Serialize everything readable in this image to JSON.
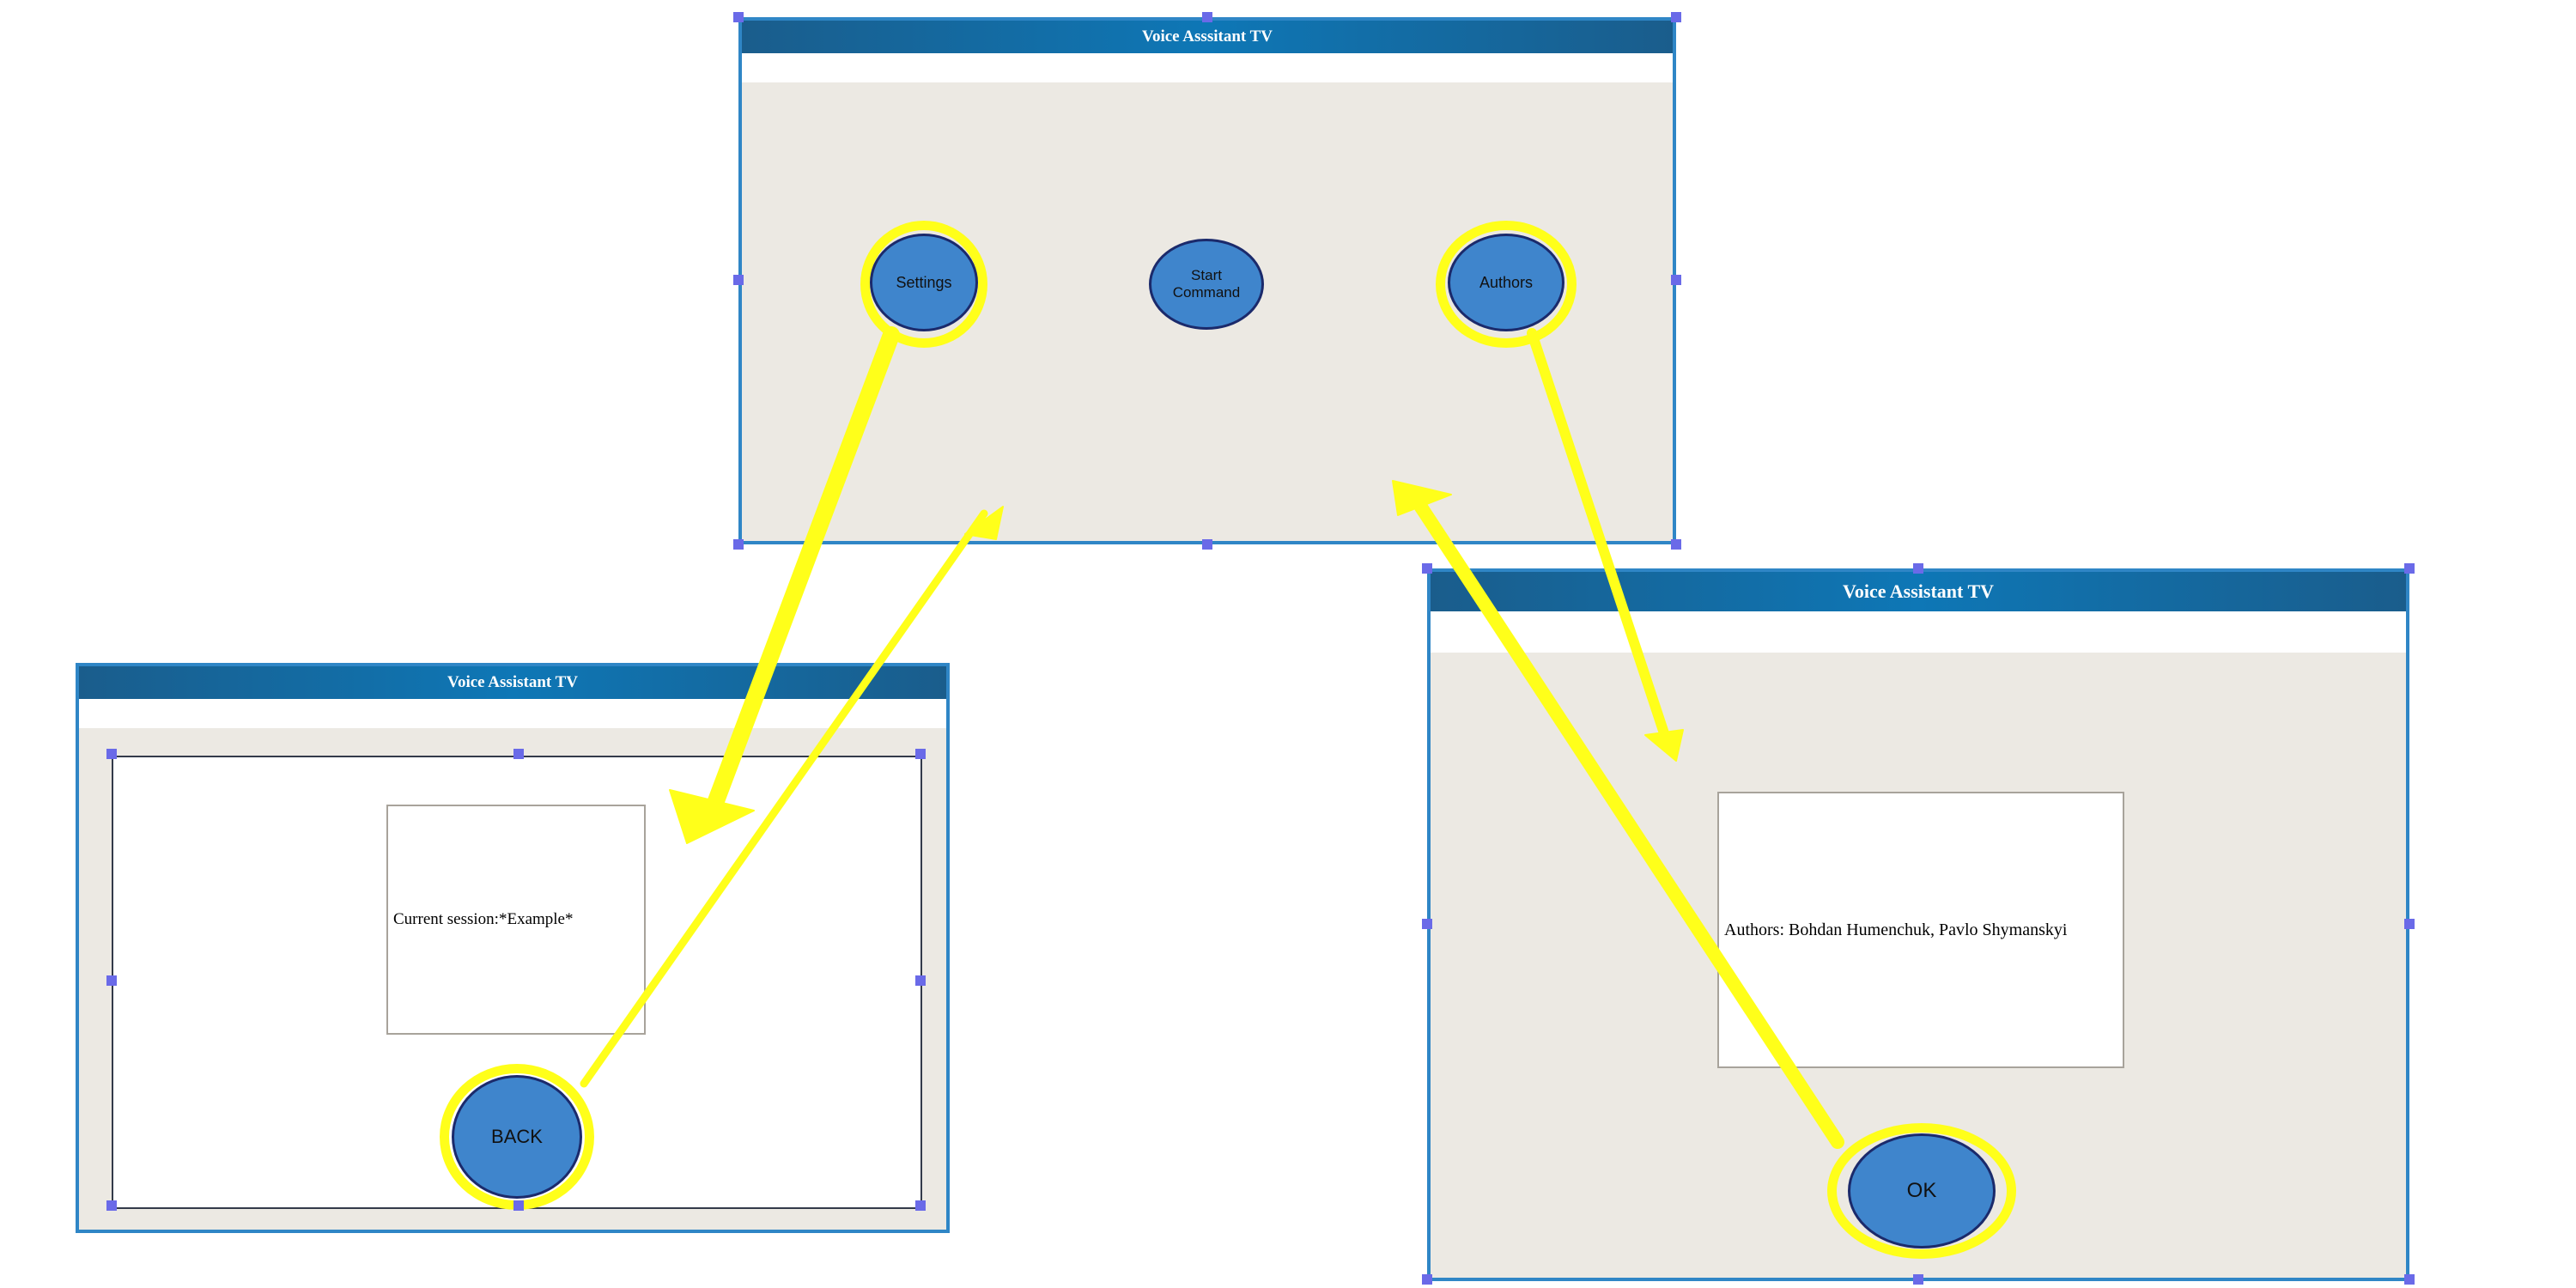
{
  "windows": {
    "main": {
      "title": "Voice Asssitant TV",
      "buttons": {
        "settings": "Settings",
        "start": "Start Command",
        "authors": "Authors"
      }
    },
    "settings": {
      "title": "Voice Assistant TV",
      "session_text": "Current session:*Example*",
      "back": "BACK"
    },
    "authors": {
      "title": "Voice Assistant TV",
      "authors_text": "Authors: Bohdan Humenchuk, Pavlo Shymanskyi",
      "ok": "OK"
    }
  },
  "colors": {
    "arrow": "#ffff1a",
    "title_bar": "#0e77b6",
    "button_fill": "#3f85cc",
    "window_bg": "#ece9e3",
    "handle": "#6a6ae8"
  }
}
